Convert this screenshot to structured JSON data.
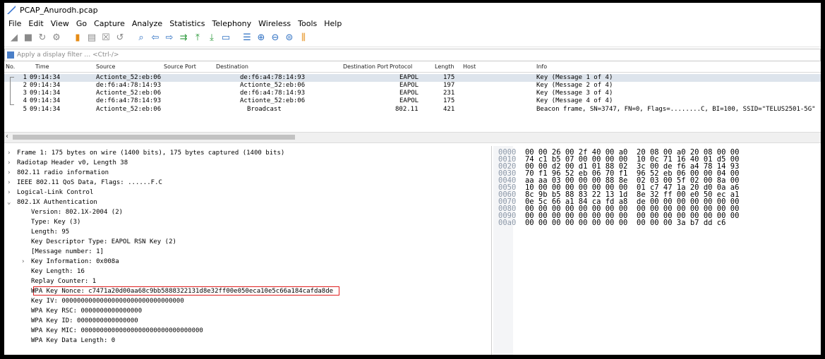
{
  "title": "PCAP_Anurodh.pcap",
  "menu": [
    "File",
    "Edit",
    "View",
    "Go",
    "Capture",
    "Analyze",
    "Statistics",
    "Telephony",
    "Wireless",
    "Tools",
    "Help"
  ],
  "toolbar_icons": [
    {
      "name": "shark-fin-start-icon",
      "glyph": "◢",
      "color": "gray"
    },
    {
      "name": "stop-capture-icon",
      "glyph": "■",
      "color": "gray"
    },
    {
      "name": "restart-capture-icon",
      "glyph": "↻",
      "color": "gray"
    },
    {
      "name": "capture-options-icon",
      "glyph": "⚙",
      "color": "gray"
    },
    {
      "name": "open-file-icon",
      "glyph": "▮",
      "color": "orange"
    },
    {
      "name": "save-file-icon",
      "glyph": "▤",
      "color": "gray"
    },
    {
      "name": "close-file-icon",
      "glyph": "☒",
      "color": "gray"
    },
    {
      "name": "reload-file-icon",
      "glyph": "↺",
      "color": "gray"
    },
    {
      "name": "find-packet-icon",
      "glyph": "⌕",
      "color": "blue"
    },
    {
      "name": "go-back-icon",
      "glyph": "⇦",
      "color": "blue"
    },
    {
      "name": "go-forward-icon",
      "glyph": "⇨",
      "color": "blue"
    },
    {
      "name": "go-to-packet-icon",
      "glyph": "⇉",
      "color": "green"
    },
    {
      "name": "first-packet-icon",
      "glyph": "⤒",
      "color": "green"
    },
    {
      "name": "last-packet-icon",
      "glyph": "⤓",
      "color": "green"
    },
    {
      "name": "auto-scroll-icon",
      "glyph": "▭",
      "color": "blue"
    },
    {
      "name": "colorize-icon",
      "glyph": "☰",
      "color": "blue"
    },
    {
      "name": "zoom-in-icon",
      "glyph": "⊕",
      "color": "blue"
    },
    {
      "name": "zoom-out-icon",
      "glyph": "⊖",
      "color": "blue"
    },
    {
      "name": "normal-size-icon",
      "glyph": "⊜",
      "color": "blue"
    },
    {
      "name": "resize-columns-icon",
      "glyph": "⫼",
      "color": "orange"
    }
  ],
  "filter": {
    "placeholder": "Apply a display filter … <Ctrl-/>"
  },
  "columns": [
    "No.",
    "Time",
    "Source",
    "Source Port",
    "Destination",
    "Destination Port",
    "Protocol",
    "Length",
    "Host",
    "Info"
  ],
  "packets": [
    {
      "no": "1",
      "time": "09:14:34",
      "source": "Actionte_52:eb:06",
      "destination": "de:f6:a4:78:14:93",
      "protocol": "EAPOL",
      "length": "175",
      "info": "Key (Message 1 of 4)"
    },
    {
      "no": "2",
      "time": "09:14:34",
      "source": "de:f6:a4:78:14:93",
      "destination": "Actionte_52:eb:06",
      "protocol": "EAPOL",
      "length": "197",
      "info": "Key (Message 2 of 4)"
    },
    {
      "no": "3",
      "time": "09:14:34",
      "source": "Actionte_52:eb:06",
      "destination": "de:f6:a4:78:14:93",
      "protocol": "EAPOL",
      "length": "231",
      "info": "Key (Message 3 of 4)"
    },
    {
      "no": "4",
      "time": "09:14:34",
      "source": "de:f6:a4:78:14:93",
      "destination": "Actionte_52:eb:06",
      "protocol": "EAPOL",
      "length": "175",
      "info": "Key (Message 4 of 4)"
    },
    {
      "no": "5",
      "time": "09:14:34",
      "source": "Actionte_52:eb:06",
      "destination": "Broadcast",
      "protocol": "802.11",
      "length": "421",
      "info": "Beacon frame, SN=3747, FN=0, Flags=........C, BI=100, SSID=\"TELUS2501-5G\""
    }
  ],
  "details": [
    {
      "indent": 0,
      "toggle": ">",
      "text": "Frame 1: 175 bytes on wire (1400 bits), 175 bytes captured (1400 bits)"
    },
    {
      "indent": 0,
      "toggle": ">",
      "text": "Radiotap Header v0, Length 38"
    },
    {
      "indent": 0,
      "toggle": ">",
      "text": "802.11 radio information"
    },
    {
      "indent": 0,
      "toggle": ">",
      "text": "IEEE 802.11 QoS Data, Flags: ......F.C"
    },
    {
      "indent": 0,
      "toggle": ">",
      "text": "Logical-Link Control"
    },
    {
      "indent": 0,
      "toggle": "v",
      "text": "802.1X Authentication"
    },
    {
      "indent": 1,
      "toggle": "",
      "text": "Version: 802.1X-2004 (2)"
    },
    {
      "indent": 1,
      "toggle": "",
      "text": "Type: Key (3)"
    },
    {
      "indent": 1,
      "toggle": "",
      "text": "Length: 95"
    },
    {
      "indent": 1,
      "toggle": "",
      "text": "Key Descriptor Type: EAPOL RSN Key (2)"
    },
    {
      "indent": 1,
      "toggle": "",
      "text": "[Message number: 1]"
    },
    {
      "indent": 1,
      "toggle": ">",
      "text": "Key Information: 0x008a"
    },
    {
      "indent": 1,
      "toggle": "",
      "text": "Key Length: 16"
    },
    {
      "indent": 1,
      "toggle": "",
      "text": "Replay Counter: 1"
    },
    {
      "indent": 1,
      "toggle": "",
      "text": "WPA Key Nonce: c7471a20d00aa68c9bb5888322131d8e32ff00e050eca10e5c66a184cafda8de"
    },
    {
      "indent": 1,
      "toggle": "",
      "text": "Key IV: 00000000000000000000000000000000"
    },
    {
      "indent": 1,
      "toggle": "",
      "text": "WPA Key RSC: 0000000000000000"
    },
    {
      "indent": 1,
      "toggle": "",
      "text": "WPA Key ID: 0000000000000000"
    },
    {
      "indent": 1,
      "toggle": "",
      "text": "WPA Key MIC: 00000000000000000000000000000000"
    },
    {
      "indent": 1,
      "toggle": "",
      "text": "WPA Key Data Length: 0"
    }
  ],
  "bytes": [
    {
      "offset": "0000",
      "hex": "00 00 26 00 2f 40 00 a0  20 08 00 a0 20 08 00 00"
    },
    {
      "offset": "0010",
      "hex": "74 c1 b5 07 00 00 00 00  10 0c 71 16 40 01 d5 00"
    },
    {
      "offset": "0020",
      "hex": "00 00 d2 00 d1 01 88 02  3c 00 de f6 a4 78 14 93"
    },
    {
      "offset": "0030",
      "hex": "70 f1 96 52 eb 06 70 f1  96 52 eb 06 00 00 04 00"
    },
    {
      "offset": "0040",
      "hex": "aa aa 03 00 00 00 88 8e  02 03 00 5f 02 00 8a 00"
    },
    {
      "offset": "0050",
      "hex": "10 00 00 00 00 00 00 00  01 c7 47 1a 20 d0 0a a6"
    },
    {
      "offset": "0060",
      "hex": "8c 9b b5 88 83 22 13 1d  8e 32 ff 00 e0 50 ec a1"
    },
    {
      "offset": "0070",
      "hex": "0e 5c 66 a1 84 ca fd a8  de 00 00 00 00 00 00 00"
    },
    {
      "offset": "0080",
      "hex": "00 00 00 00 00 00 00 00  00 00 00 00 00 00 00 00"
    },
    {
      "offset": "0090",
      "hex": "00 00 00 00 00 00 00 00  00 00 00 00 00 00 00 00"
    },
    {
      "offset": "00a0",
      "hex": "00 00 00 00 00 00 00 00  00 00 00 3a b7 dd c6"
    }
  ],
  "colors": {
    "selected_row": "#dde4ec",
    "highlight_border": "#e02020"
  }
}
